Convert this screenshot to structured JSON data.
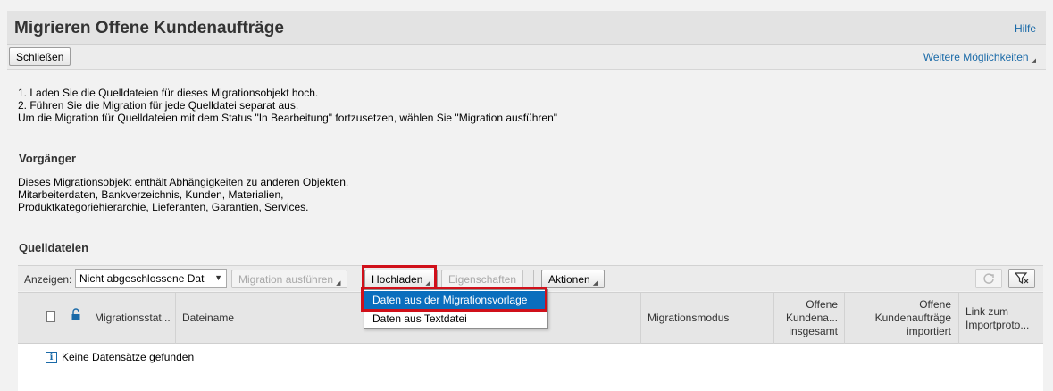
{
  "header": {
    "title": "Migrieren Offene Kundenaufträge",
    "help_label": "Hilfe"
  },
  "actionbar": {
    "close_label": "Schließen",
    "more_label": "Weitere Möglichkeiten"
  },
  "instructions": {
    "line1": "1. Laden Sie die Quelldateien für dieses Migrationsobjekt hoch.",
    "line2": "2. Führen Sie die Migration für jede Quelldatei separat aus.",
    "line3": "Um die Migration für Quelldateien mit dem Status \"In Bearbeitung\" fortzusetzen, wählen Sie \"Migration ausführen\""
  },
  "predecessor": {
    "title": "Vorgänger",
    "line1": "Dieses Migrationsobjekt enthält Abhängigkeiten zu anderen Objekten.",
    "line2": "Mitarbeiterdaten, Bankverzeichnis, Kunden, Materialien,",
    "line3": "Produktkategoriehierarchie, Lieferanten, Garantien, Services."
  },
  "source_files": {
    "title": "Quelldateien",
    "toolbar": {
      "show_label": "Anzeigen:",
      "filter_value": "Nicht abgeschlossene Dat",
      "run_migration_label": "Migration ausführen",
      "upload_label": "Hochladen",
      "properties_label": "Eigenschaften",
      "actions_label": "Aktionen"
    },
    "upload_menu": [
      "Daten aus der Migrationsvorlage",
      "Daten aus Textdatei"
    ],
    "columns": {
      "status": "Migrationsstat...",
      "filename": "Dateiname",
      "mode": "Migrationsmodus",
      "total": [
        "Offene",
        "Kundena...",
        "insgesamt"
      ],
      "imported": [
        "Offene",
        "Kundenaufträge",
        "importiert"
      ],
      "log_link": [
        "Link zum",
        "Importproto..."
      ]
    },
    "empty_text": "Keine Datensätze gefunden"
  },
  "colors": {
    "link": "#1a6aa8",
    "highlight": "#d0101a",
    "selected": "#0a6ebd"
  }
}
